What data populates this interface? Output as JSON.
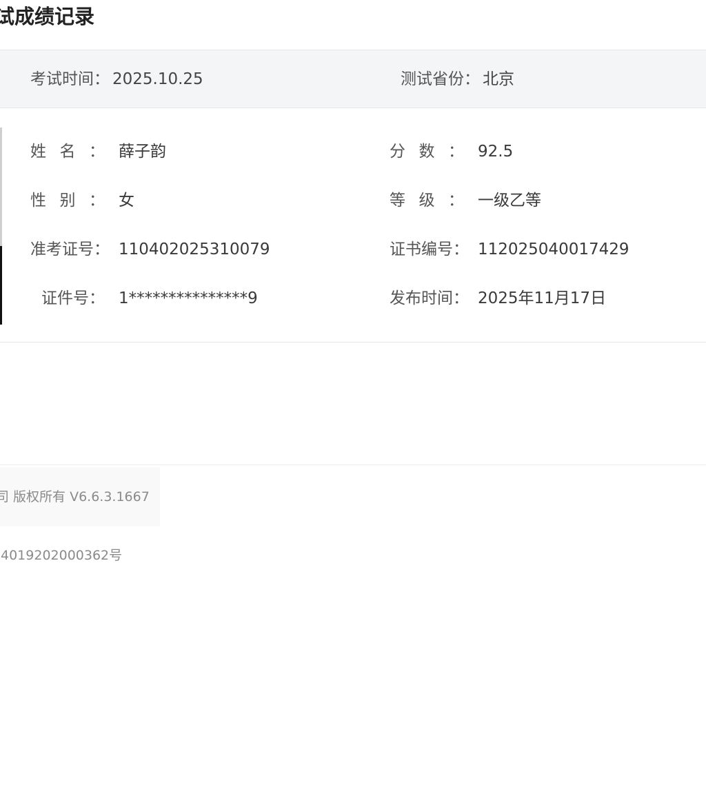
{
  "page": {
    "title": "试成绩记录"
  },
  "exam_info": {
    "time_label": "考试时间：",
    "time_value": "2025.10.25",
    "province_label": "测试省份：",
    "province_value": "北京"
  },
  "result": {
    "name_label": "姓名",
    "name_colon": "：",
    "name_value": "薛子韵",
    "score_label": "分数",
    "score_colon": "：",
    "score_value": "92.5",
    "gender_label": "性别",
    "gender_colon": "：",
    "gender_value": "女",
    "grade_label": "等级",
    "grade_colon": "：",
    "grade_value": "一级乙等",
    "ticket_label": "准考证号：",
    "ticket_value": "110402025310079",
    "cert_label": "证书编号：",
    "cert_value": "112025040017429",
    "id_label": "证件号：",
    "id_value": "1***************9",
    "publish_label": "发布时间：",
    "publish_value": "2025年11月17日"
  },
  "footer": {
    "copyright": "司 版权所有 V6.6.3.1667",
    "icp": "4019202000362号"
  }
}
